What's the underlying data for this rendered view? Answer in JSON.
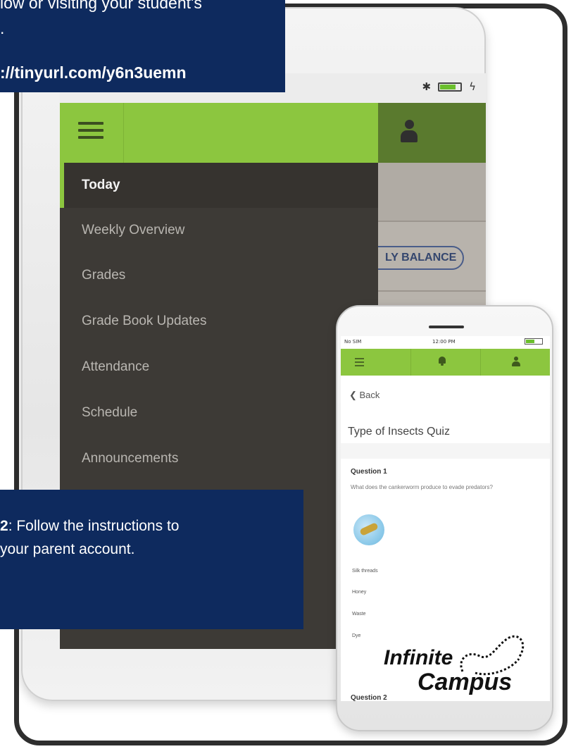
{
  "callout_top": {
    "line1": "low or visiting your student's",
    "line2": ".",
    "url": "://tinyurl.com/y6n3uemn"
  },
  "callout_bottom": {
    "step": "2",
    "line1_rest": ": Follow the instructions to",
    "line2": "your parent account."
  },
  "tablet": {
    "status_bar": {
      "icons": [
        "bluetooth-icon",
        "battery-icon",
        "charging-icon"
      ]
    },
    "menu": [
      {
        "label": "Today",
        "active": true
      },
      {
        "label": "Weekly Overview",
        "active": false
      },
      {
        "label": "Grades",
        "active": false
      },
      {
        "label": "Grade Book Updates",
        "active": false
      },
      {
        "label": "Attendance",
        "active": false
      },
      {
        "label": "Schedule",
        "active": false
      },
      {
        "label": "Announcements",
        "active": false
      }
    ],
    "balance_button": "LY BALANCE"
  },
  "phone": {
    "status": {
      "carrier": "No SIM",
      "time": "12:00 PM"
    },
    "back": "Back",
    "quiz_title": "Type of Insects Quiz",
    "question1": {
      "title": "Question 1",
      "text": "What does the cankerworm produce to evade predators?",
      "options": [
        "Silk threads",
        "Honey",
        "Waste",
        "Dye"
      ]
    },
    "question2_partial": "Question 2"
  },
  "logo": {
    "line1": "Infinite",
    "line2": "Campus"
  },
  "colors": {
    "brand_green": "#8cc63f",
    "dark_green": "#5a7a2e",
    "drawer_bg": "#3d3a36",
    "callout_navy": "#0e2a5e"
  }
}
